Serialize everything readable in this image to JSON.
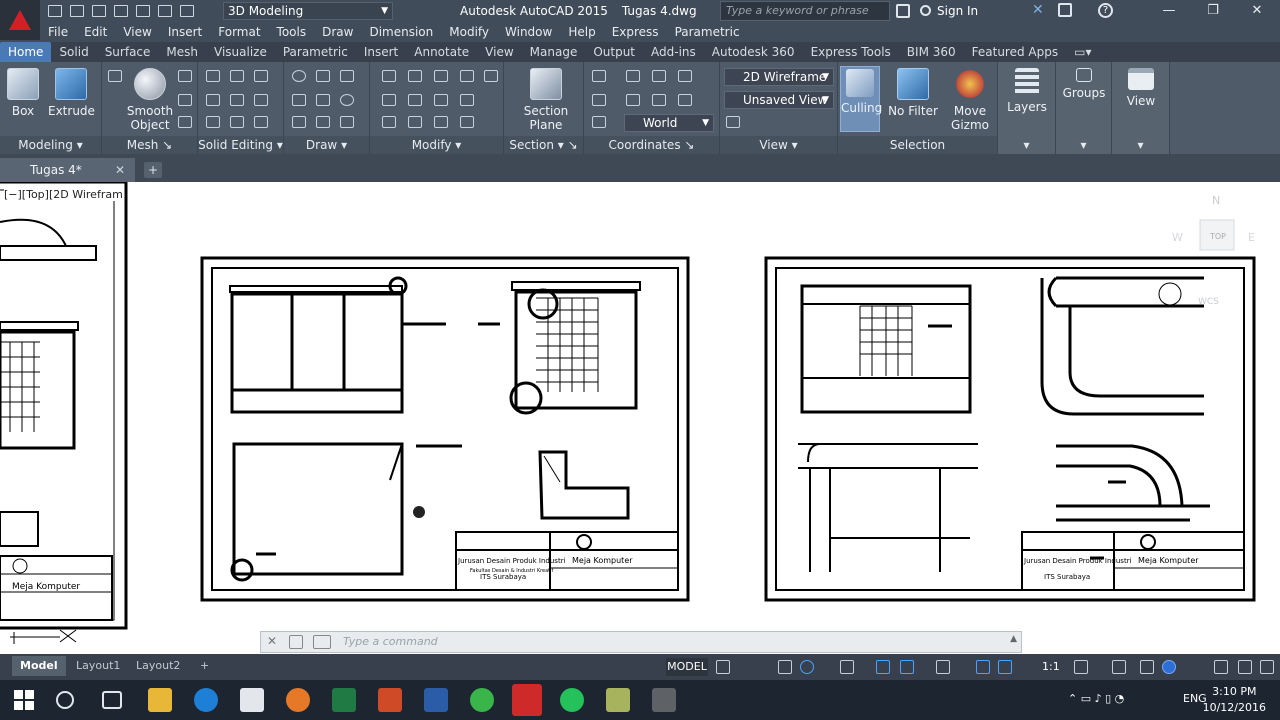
{
  "window": {
    "app_title": "Autodesk AutoCAD 2015",
    "file_name": "Tugas 4.dwg",
    "workspace": "3D Modeling",
    "search_placeholder": "Type a keyword or phrase",
    "sign_in": "Sign In"
  },
  "menu": [
    "File",
    "Edit",
    "View",
    "Insert",
    "Format",
    "Tools",
    "Draw",
    "Dimension",
    "Modify",
    "Window",
    "Help",
    "Express",
    "Parametric"
  ],
  "ribbon_tabs": [
    "Home",
    "Solid",
    "Surface",
    "Mesh",
    "Visualize",
    "Parametric",
    "Insert",
    "Annotate",
    "View",
    "Manage",
    "Output",
    "Add-ins",
    "Autodesk 360",
    "Express Tools",
    "BIM 360",
    "Featured Apps"
  ],
  "ribbon": {
    "modeling": {
      "title": "Modeling",
      "box": "Box",
      "extrude": "Extrude",
      "smooth1": "Smooth",
      "smooth2": "Object"
    },
    "mesh": {
      "title": "Mesh"
    },
    "solid_editing": {
      "title": "Solid Editing"
    },
    "draw": {
      "title": "Draw"
    },
    "modify": {
      "title": "Modify"
    },
    "section": {
      "title": "Section",
      "label1": "Section",
      "label2": "Plane"
    },
    "coordinates": {
      "title": "Coordinates",
      "ucs": "World"
    },
    "view": {
      "title": "View",
      "visual_style": "2D Wireframe",
      "saved_view": "Unsaved View"
    },
    "selection": {
      "title": "Selection",
      "culling": "Culling",
      "no_filter": "No Filter",
      "move1": "Move",
      "move2": "Gizmo"
    },
    "layers": "Layers",
    "groups": "Groups",
    "view_btn": "View"
  },
  "doc_tab": "Tugas 4*",
  "viewport_label": "[−][Top][2D Wirefram",
  "viewcube": {
    "top": "TOP",
    "n": "N",
    "w": "W",
    "e": "E",
    "wcs": "WCS"
  },
  "drawings": {
    "left_title": "Meja Komputer",
    "mid_institution1": "Jurusan Desain Produk Industri",
    "mid_institution2": "Fakultas Desain & Industri Kreatif",
    "mid_city": "ITS Surabaya",
    "mid_title": "Meja Komputer",
    "right_institution1": "Jurusan Desain Produk Industri",
    "right_city": "ITS Surabaya",
    "right_title": "Meja Komputer"
  },
  "command": {
    "placeholder": "Type a command"
  },
  "layout_tabs": [
    "Model",
    "Layout1",
    "Layout2"
  ],
  "status_model": "MODEL",
  "status_scale": "1:1",
  "taskbar": {
    "lang": "ENG",
    "time": "3:10 PM",
    "date": "10/12/2016"
  },
  "colors": {
    "accent": "#4a7ab5",
    "ribbon": "#4f5b69",
    "title": "#414c5a",
    "taskbar": "#1c2530"
  }
}
